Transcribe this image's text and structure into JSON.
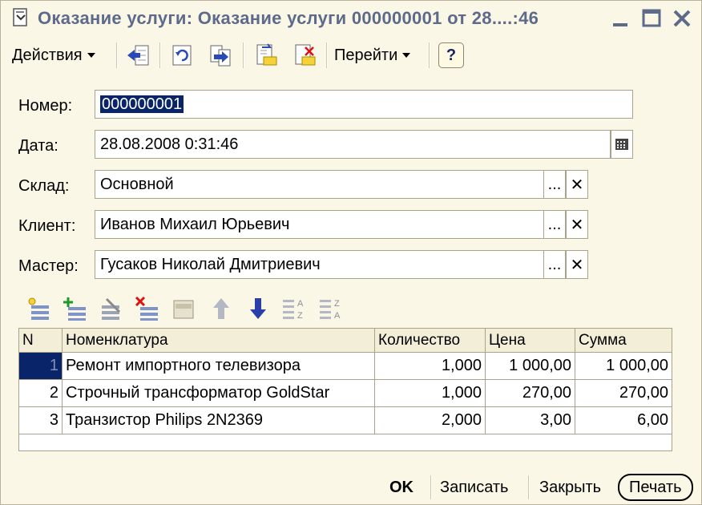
{
  "window": {
    "title": "Оказание услуги: Оказание услуги 000000001 от 28....:46"
  },
  "toolbar": {
    "actions_label": "Действия",
    "goto_label": "Перейти",
    "help_label": "?"
  },
  "form": {
    "number": {
      "label": "Номер:",
      "value": "000000001"
    },
    "date": {
      "label": "Дата:",
      "value": "28.08.2008  0:31:46"
    },
    "warehouse": {
      "label": "Склад:",
      "value": "Основной"
    },
    "client": {
      "label": "Клиент:",
      "value": "Иванов Михаил Юрьевич"
    },
    "master": {
      "label": "Мастер:",
      "value": "Гусаков Николай Дмитриевич"
    },
    "select_button": "...",
    "clear_button": "✕"
  },
  "table": {
    "columns": [
      "N",
      "Номенклатура",
      "Количество",
      "Цена",
      "Сумма"
    ],
    "rows": [
      {
        "n": "1",
        "item": "Ремонт импортного телевизора",
        "qty": "1,000",
        "price": "1 000,00",
        "sum": "1 000,00"
      },
      {
        "n": "2",
        "item": "Строчный трансформатор GoldStar",
        "qty": "1,000",
        "price": "270,00",
        "sum": "270,00"
      },
      {
        "n": "3",
        "item": "Транзистор Philips 2N2369",
        "qty": "2,000",
        "price": "3,00",
        "sum": "6,00"
      }
    ]
  },
  "buttons": {
    "ok": "OK",
    "save": "Записать",
    "close": "Закрыть",
    "print": "Печать"
  }
}
